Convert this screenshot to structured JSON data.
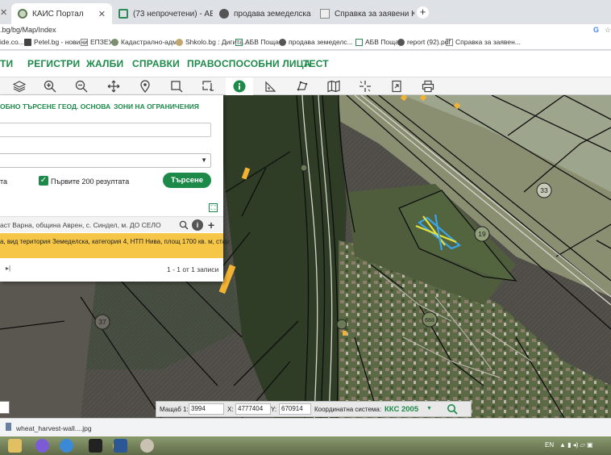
{
  "browser": {
    "tabs": [
      {
        "label": "КАИС Портал",
        "active": true
      },
      {
        "label": "(73 непрочетени) - АБВ поща",
        "active": false
      },
      {
        "label": "продава земеделска земя",
        "active": false
      },
      {
        "label": "Справка за заявени Кадастрал",
        "active": false
      }
    ],
    "new_tab": "+",
    "address": ".bg/bg/Map/Index",
    "bookmarks": [
      "ide.co...",
      "Petel.bg - новини",
      "ЕПЗЕУ",
      "Кадастрално-адм...",
      "Shkolo.bg : Дигита...",
      "АБВ Поща",
      "продава земеделс...",
      "АБВ Поща",
      "report (92).pdf",
      "Справка за заявен..."
    ]
  },
  "nav": {
    "items": [
      "ТИ",
      "РЕГИСТРИ",
      "ЖАЛБИ",
      "СПРАВКИ",
      "ПРАВОСПОСОБНИ ЛИЦА",
      "ТЕСТ"
    ]
  },
  "toolbar": {
    "tools": [
      "layers-icon",
      "zoom-in-icon",
      "zoom-out-icon",
      "pan-icon",
      "location-pin-icon",
      "select-rectangle-icon",
      "select-area-icon",
      "info-icon",
      "measure-angle-icon",
      "measure-area-icon",
      "map-icon",
      "crosshair-icon",
      "export-icon",
      "print-icon"
    ],
    "active_tool": "info-icon"
  },
  "panel": {
    "tabs": [
      "ОБНО ТЪРСЕНЕ",
      "ГЕОД. ОСНОВА",
      "ЗОНИ НА ОГРАНИЧЕНИЯ"
    ],
    "field_value": "",
    "select_value": "",
    "left_label": "та",
    "checkbox_label": "Първите 200 резултата",
    "checkbox_checked": true,
    "search_button": "Търсене",
    "expand_icon": "⛶",
    "result_header": "аст Варна, община Аврен, с. Синдел, м. ДО СЕЛО",
    "result_text": "а, вид територия Земеделска, категория 4, НТП Нива, площ 1700 кв. м, стар",
    "pager_arrow": "▸|",
    "pager": "1 - 1 от 1 записи"
  },
  "map": {
    "parcel_labels": [
      "33",
      "19",
      "37",
      "688"
    ],
    "colors": {
      "highlight": "#f2b233",
      "selection_blue": "#3ba4e6",
      "selection_yellow": "#e6e13b"
    }
  },
  "coords": {
    "scale_label": "Мащаб 1:",
    "scale_value": "3994",
    "x_label": "X:",
    "x_value": "4777404",
    "y_label": "Y:",
    "y_value": "670914",
    "system_label": "Координатна система:",
    "system_value": "ККС 2005"
  },
  "downloads": {
    "file": "wheat_harvest-wall....jpg"
  },
  "taskbar": {
    "lang": "EN",
    "apps": [
      "file-explorer-icon",
      "viber-icon",
      "explorer-icon",
      "terminal-icon",
      "chrome-icon",
      "word-icon",
      "paint-icon"
    ]
  }
}
